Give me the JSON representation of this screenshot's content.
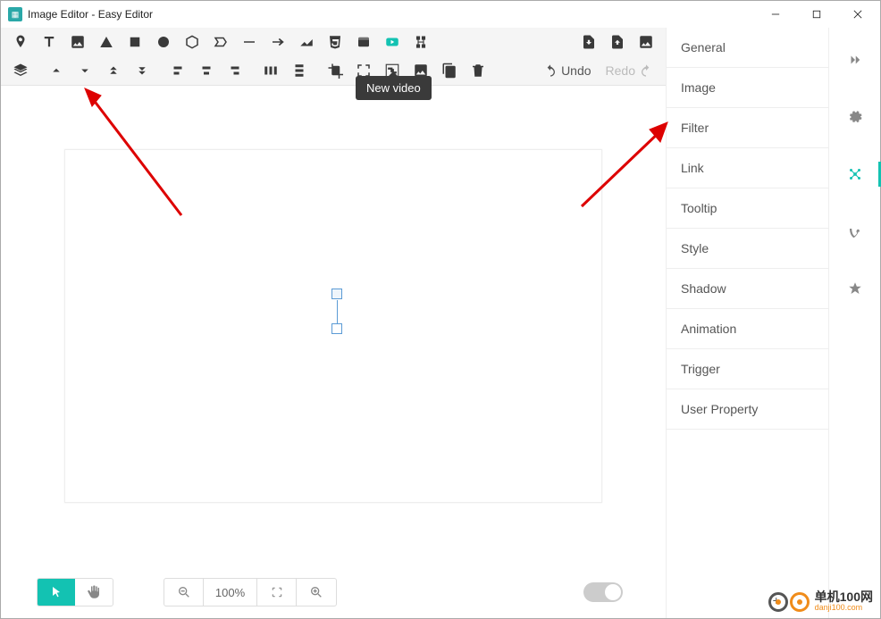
{
  "window": {
    "title": "Image Editor - Easy Editor"
  },
  "tooltip": {
    "text": "New video"
  },
  "undo": {
    "label": "Undo"
  },
  "redo": {
    "label": "Redo"
  },
  "zoom": {
    "percent": "100%"
  },
  "panels": {
    "items": [
      {
        "label": "General"
      },
      {
        "label": "Image"
      },
      {
        "label": "Filter"
      },
      {
        "label": "Link"
      },
      {
        "label": "Tooltip"
      },
      {
        "label": "Style"
      },
      {
        "label": "Shadow"
      },
      {
        "label": "Animation"
      },
      {
        "label": "Trigger"
      },
      {
        "label": "User Property"
      }
    ]
  },
  "watermark": {
    "cn": "单机100网",
    "en": "danji100.com"
  },
  "colors": {
    "accent": "#13c2b2",
    "arrow": "#d00000"
  }
}
